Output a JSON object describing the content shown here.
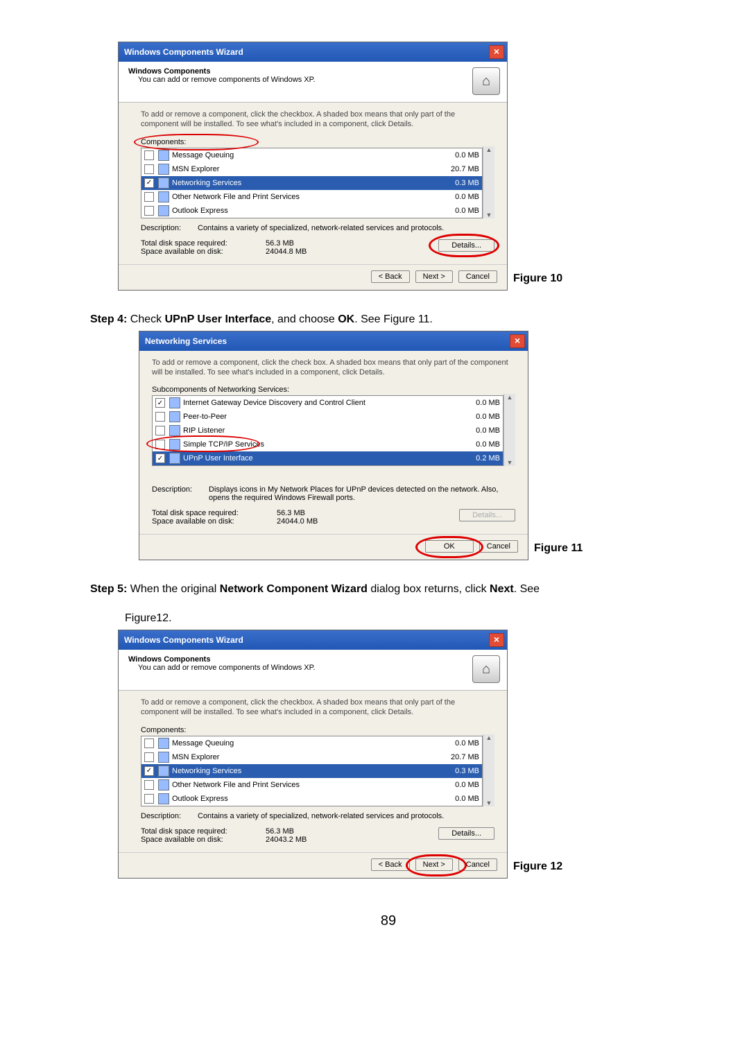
{
  "figures": {
    "f10": {
      "title": "Windows Components Wizard",
      "hdr_title": "Windows Components",
      "hdr_sub": "You can add or remove components of Windows XP.",
      "instr": "To add or remove a component, click the checkbox.  A shaded box means that only part of the component will be installed.  To see what's included in a component, click Details.",
      "list_label": "Components:",
      "rows": [
        {
          "checked": false,
          "name": "Message Queuing",
          "size": "0.0 MB"
        },
        {
          "checked": false,
          "name": "MSN Explorer",
          "size": "20.7 MB"
        },
        {
          "checked": true,
          "name": "Networking Services",
          "size": "0.3 MB",
          "selected": true
        },
        {
          "checked": false,
          "name": "Other Network File and Print Services",
          "size": "0.0 MB"
        },
        {
          "checked": false,
          "name": "Outlook Express",
          "size": "0.0 MB"
        }
      ],
      "desc_lbl": "Description:",
      "desc_val": "Contains a variety of specialized, network-related services and protocols.",
      "total_lbl": "Total disk space required:",
      "total_val": "56.3 MB",
      "avail_lbl": "Space available on disk:",
      "avail_val": "24044.8 MB",
      "details_btn": "Details...",
      "back_btn": "< Back",
      "next_btn": "Next >",
      "cancel_btn": "Cancel",
      "caption": "Figure 10"
    },
    "f11": {
      "title": "Networking Services",
      "instr": "To add or remove a component, click the check box. A shaded box means that only part of the component will be installed. To see what's included in a component, click Details.",
      "list_label": "Subcomponents of Networking Services:",
      "rows": [
        {
          "checked": true,
          "name": "Internet Gateway Device Discovery and Control Client",
          "size": "0.0 MB"
        },
        {
          "checked": false,
          "name": "Peer-to-Peer",
          "size": "0.0 MB"
        },
        {
          "checked": false,
          "name": "RIP Listener",
          "size": "0.0 MB"
        },
        {
          "checked": false,
          "name": "Simple TCP/IP Services",
          "size": "0.0 MB"
        },
        {
          "checked": true,
          "name": "UPnP User Interface",
          "size": "0.2 MB",
          "selected": true
        }
      ],
      "desc_lbl": "Description:",
      "desc_val": "Displays icons in My Network Places for UPnP devices detected on the network. Also, opens the required Windows Firewall ports.",
      "total_lbl": "Total disk space required:",
      "total_val": "56.3 MB",
      "avail_lbl": "Space available on disk:",
      "avail_val": "24044.0 MB",
      "details_btn": "Details...",
      "ok_btn": "OK",
      "cancel_btn": "Cancel",
      "caption": "Figure 11"
    },
    "f12": {
      "title": "Windows Components Wizard",
      "hdr_title": "Windows Components",
      "hdr_sub": "You can add or remove components of Windows XP.",
      "instr": "To add or remove a component, click the checkbox.  A shaded box means that only part of the component will be installed.  To see what's included in a component, click Details.",
      "list_label": "Components:",
      "rows": [
        {
          "checked": false,
          "name": "Message Queuing",
          "size": "0.0 MB"
        },
        {
          "checked": false,
          "name": "MSN Explorer",
          "size": "20.7 MB"
        },
        {
          "checked": true,
          "name": "Networking Services",
          "size": "0.3 MB",
          "selected": true
        },
        {
          "checked": false,
          "name": "Other Network File and Print Services",
          "size": "0.0 MB"
        },
        {
          "checked": false,
          "name": "Outlook Express",
          "size": "0.0 MB"
        }
      ],
      "desc_lbl": "Description:",
      "desc_val": "Contains a variety of specialized, network-related services and protocols.",
      "total_lbl": "Total disk space required:",
      "total_val": "56.3 MB",
      "avail_lbl": "Space available on disk:",
      "avail_val": "24043.2 MB",
      "details_btn": "Details...",
      "back_btn": "< Back",
      "next_btn": "Next >",
      "cancel_btn": "Cancel",
      "caption": "Figure 12"
    }
  },
  "text": {
    "step4_a": "Step 4:",
    "step4_b": " Check ",
    "step4_c": "UPnP User Interface",
    "step4_d": ", and choose ",
    "step4_e": "OK",
    "step4_f": ". See Figure 11.",
    "step5_a": "Step 5:",
    "step5_b": " When the original ",
    "step5_c": "Network Component Wizard",
    "step5_d": " dialog box returns, click ",
    "step5_e": "Next",
    "step5_f": ". See",
    "step5_line2": "Figure12.",
    "page_num": "89"
  }
}
